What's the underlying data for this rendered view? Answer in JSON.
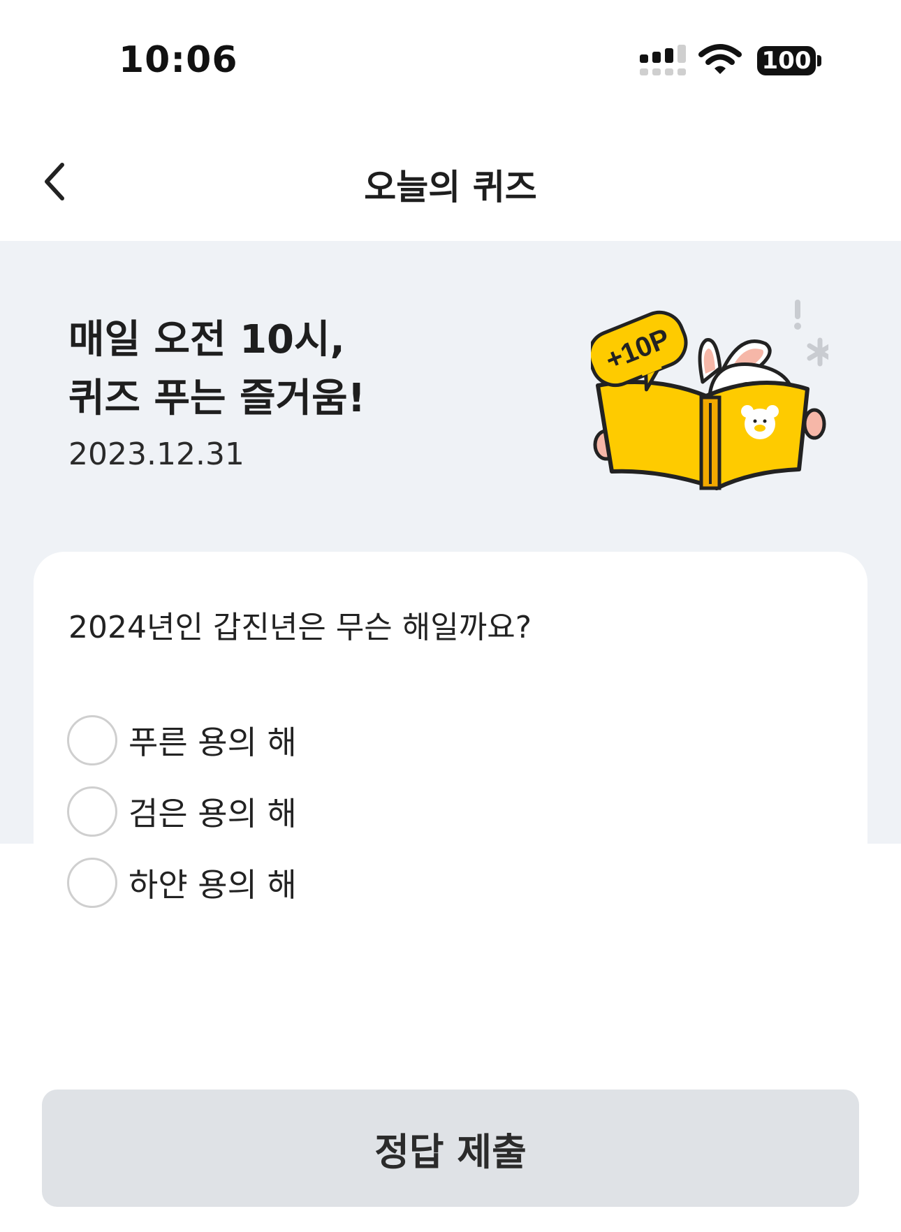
{
  "status": {
    "time": "10:06",
    "battery": "100"
  },
  "nav": {
    "title": "오늘의 퀴즈"
  },
  "hero": {
    "title_line1": "매일 오전 10시,",
    "title_line2": "퀴즈 푸는 즐거움!",
    "date": "2023.12.31",
    "badge": "+10P"
  },
  "quiz": {
    "question": "2024년인 갑진년은 무슨 해일까요?",
    "options": [
      {
        "label": "푸른 용의 해",
        "selected": false
      },
      {
        "label": "검은 용의 해",
        "selected": false
      },
      {
        "label": "하얀 용의 해",
        "selected": false
      }
    ]
  },
  "submit": {
    "label": "정답 제출"
  },
  "colors": {
    "hero_bg": "#eff2f6",
    "accent_yellow": "#fecb00",
    "button_bg": "#dfe2e6",
    "radio_border": "#cfcfcf"
  }
}
